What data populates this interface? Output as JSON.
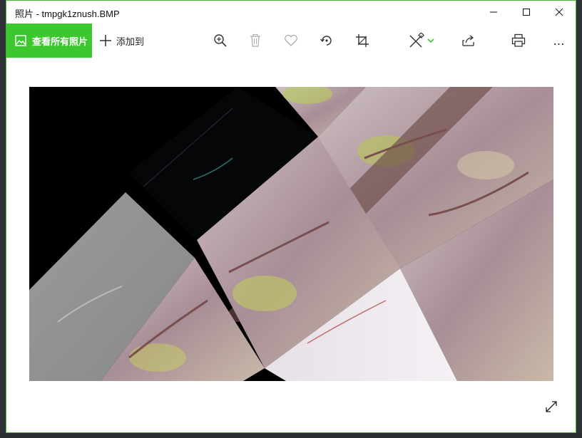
{
  "window": {
    "title": "照片 - tmpgk1znush.BMP",
    "controls": {
      "minimize": "minimize",
      "maximize": "maximize",
      "close": "close"
    }
  },
  "toolbar": {
    "see_all_label": "查看所有照片",
    "add_to_label": "添加到",
    "icons": [
      "zoom-in-icon",
      "delete-icon",
      "favorite-icon",
      "rotate-icon",
      "crop-icon",
      "edit-draw-icon",
      "share-icon",
      "print-icon",
      "more-icon"
    ],
    "more_label": "…"
  },
  "colors": {
    "accent": "#3cc72e",
    "window_border": "#47b42f",
    "image_bg": "#000000"
  }
}
